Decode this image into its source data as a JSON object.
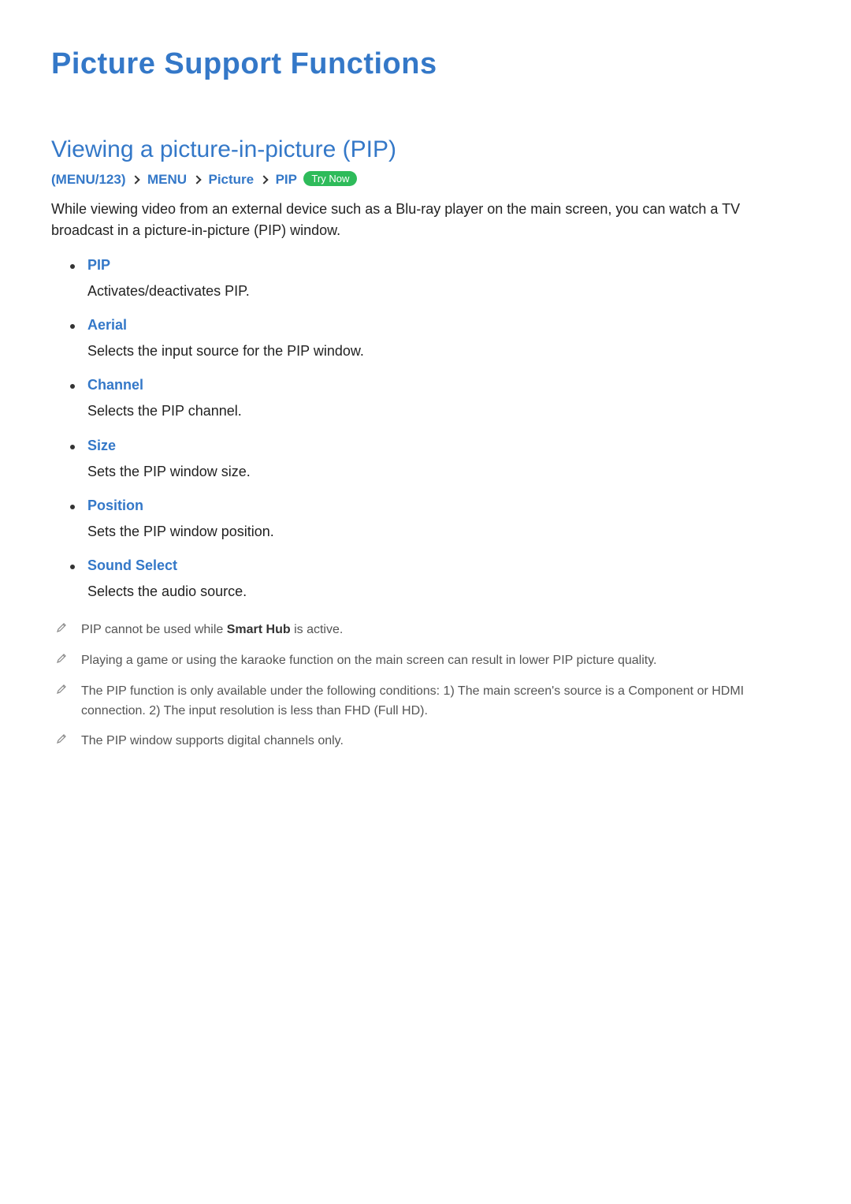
{
  "page_title": "Picture Support Functions",
  "section_title": "Viewing a picture-in-picture (PIP)",
  "breadcrumb": {
    "item1": "MENU/123",
    "item2": "MENU",
    "item3": "Picture",
    "item4": "PIP",
    "try_now": "Try Now"
  },
  "intro": "While viewing video from an external device such as a Blu-ray player on the main screen, you can watch a TV broadcast in a picture-in-picture (PIP) window.",
  "settings": [
    {
      "name": "PIP",
      "desc": "Activates/deactivates PIP."
    },
    {
      "name": "Aerial",
      "desc": "Selects the input source for the PIP window."
    },
    {
      "name": "Channel",
      "desc": "Selects the PIP channel."
    },
    {
      "name": "Size",
      "desc": "Sets the PIP window size."
    },
    {
      "name": "Position",
      "desc": "Sets the PIP window position."
    },
    {
      "name": "Sound Select",
      "desc": "Selects the audio source."
    }
  ],
  "notes": {
    "n0_before": "PIP cannot be used while ",
    "n0_bold": "Smart Hub",
    "n0_after": " is active.",
    "n1": "Playing a game or using the karaoke function on the main screen can result in lower PIP picture quality.",
    "n2": "The PIP function is only available under the following conditions: 1) The main screen's source is a Component or HDMI connection. 2) The input resolution is less than FHD (Full HD).",
    "n3": "The PIP window supports digital channels only."
  }
}
